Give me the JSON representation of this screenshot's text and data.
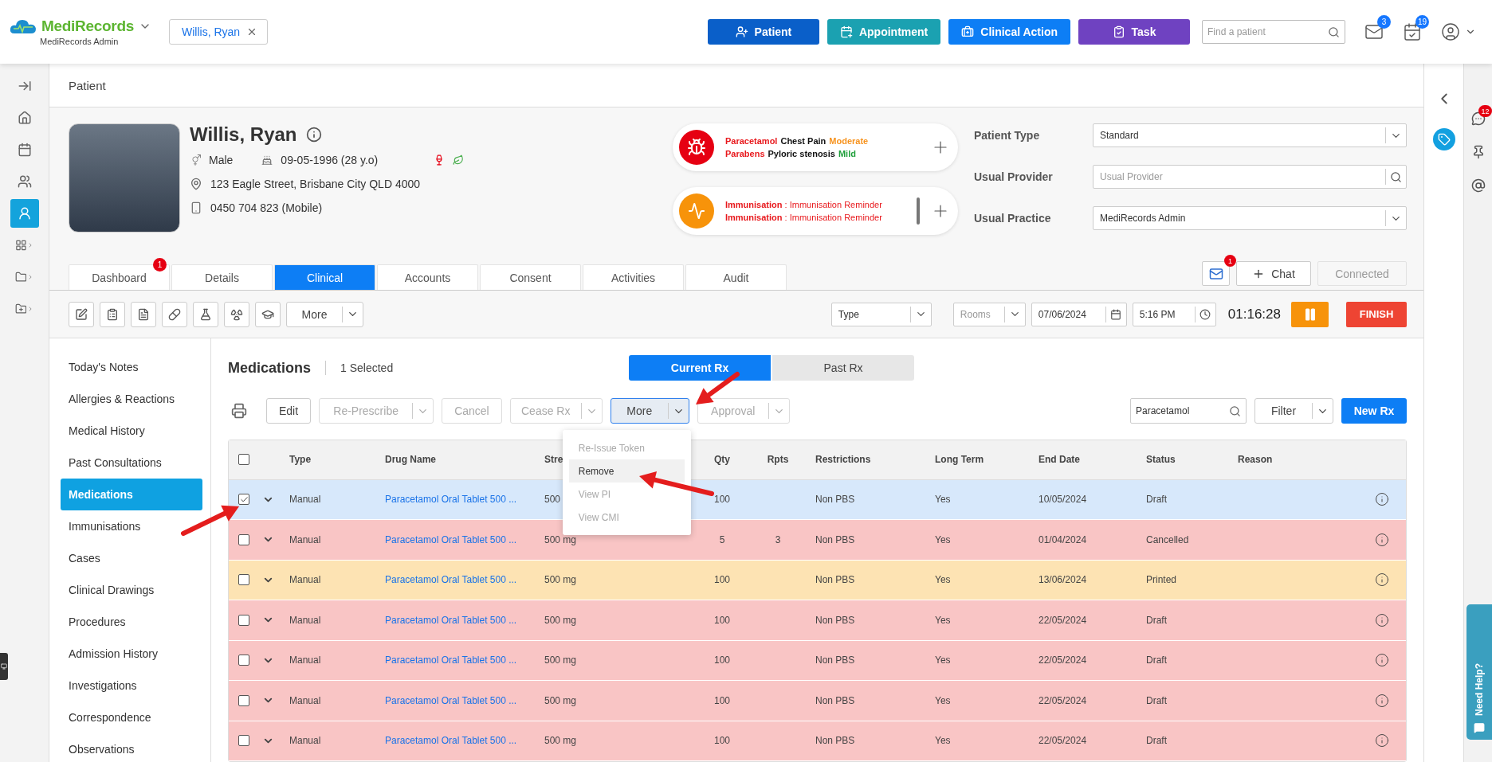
{
  "header": {
    "brand": "MediRecords",
    "brand_subtitle": "MediRecords Admin",
    "open_patient": "Willis, Ryan",
    "actions": [
      {
        "label": "Patient",
        "kind": "patient",
        "color": "#0a5fc9"
      },
      {
        "label": "Appointment",
        "kind": "appointment",
        "color": "#1ba1b1"
      },
      {
        "label": "Clinical Action",
        "kind": "clinical",
        "color": "#0d7ef5"
      },
      {
        "label": "Task",
        "kind": "task",
        "color": "#6f42c1"
      }
    ],
    "search": {
      "placeholder": "Find a patient"
    },
    "mail_badge": "3",
    "calendar_badge": "19"
  },
  "breadcrumb": "Patient",
  "patient": {
    "name": "Willis, Ryan",
    "gender": "Male",
    "dob": "09-05-1996 (28 y.o)",
    "address": "123 Eagle Street, Brisbane City QLD 4000",
    "phone": "0450 704 823 (Mobile)"
  },
  "allergies": [
    {
      "substance": "Paracetamol",
      "reaction": "Chest Pain",
      "severity": "Moderate",
      "color": "#f7931e"
    },
    {
      "substance": "Parabens",
      "reaction": "Pyloric stenosis",
      "severity": "Mild",
      "color": "#1e9e3a"
    }
  ],
  "reminders": [
    {
      "text": "**Immunisation** : Immunisation Reminder"
    },
    {
      "text": "**Immunisation** : Immunisation Reminder"
    }
  ],
  "fields": [
    {
      "label": "Patient Type",
      "kind": "select",
      "value": "Standard"
    },
    {
      "label": "Usual Provider",
      "kind": "search",
      "placeholder": "Usual Provider"
    },
    {
      "label": "Usual Practice",
      "kind": "select",
      "value": "MediRecords Admin"
    }
  ],
  "messages_badge": "1",
  "chat": "Chat",
  "connection": "Connected",
  "tabs": [
    {
      "label": "Dashboard",
      "selected": false,
      "badge": "1"
    },
    {
      "label": "Details",
      "selected": false
    },
    {
      "label": "Clinical",
      "selected": true
    },
    {
      "label": "Accounts",
      "selected": false
    },
    {
      "label": "Consent",
      "selected": false
    },
    {
      "label": "Activities",
      "selected": false
    },
    {
      "label": "Audit",
      "selected": false
    }
  ],
  "toolbar": {
    "more": "More",
    "type_placeholder": "Type",
    "rooms_placeholder": "Rooms",
    "date": "07/06/2024",
    "time": "5:16 PM",
    "timer": "01:16:28",
    "finish": "FINISH"
  },
  "side_panel": {
    "chat_badge": "12",
    "help": "Need Help?"
  },
  "nav": [
    {
      "label": "Today's Notes",
      "selected": false
    },
    {
      "label": "Allergies & Reactions",
      "selected": false
    },
    {
      "label": "Medical History",
      "selected": false
    },
    {
      "label": "Past Consultations",
      "selected": false
    },
    {
      "label": "Medications",
      "selected": true
    },
    {
      "label": "Immunisations",
      "selected": false
    },
    {
      "label": "Cases",
      "selected": false
    },
    {
      "label": "Clinical Drawings",
      "selected": false
    },
    {
      "label": "Procedures",
      "selected": false
    },
    {
      "label": "Admission History",
      "selected": false
    },
    {
      "label": "Investigations",
      "selected": false
    },
    {
      "label": "Correspondence",
      "selected": false
    },
    {
      "label": "Observations",
      "selected": false
    }
  ],
  "medications": {
    "title": "Medications",
    "selection": "1 Selected",
    "views": [
      {
        "label": "Current Rx",
        "selected": true
      },
      {
        "label": "Past Rx",
        "selected": false
      }
    ],
    "actions": [
      {
        "label": "Edit",
        "disabled": false,
        "split": false,
        "open": false
      },
      {
        "label": "Re-Prescribe",
        "disabled": true,
        "split": true,
        "open": false
      },
      {
        "label": "Cancel",
        "disabled": true,
        "split": false,
        "open": false
      },
      {
        "label": "Cease Rx",
        "disabled": true,
        "split": true,
        "open": false
      },
      {
        "label": "More",
        "disabled": false,
        "split": true,
        "open": true
      },
      {
        "label": "Approval",
        "disabled": true,
        "split": true,
        "open": false
      }
    ],
    "more_menu": [
      {
        "label": "Re-Issue Token",
        "disabled": true,
        "highlighted": false
      },
      {
        "label": "Remove",
        "disabled": false,
        "highlighted": true
      },
      {
        "label": "View PI",
        "disabled": true,
        "highlighted": false
      },
      {
        "label": "View CMI",
        "disabled": true,
        "highlighted": false
      }
    ],
    "search": "Paracetamol",
    "filter": "Filter",
    "new": "New Rx",
    "select_all": false,
    "columns": [
      "Type",
      "Drug Name",
      "Stre",
      "Qty",
      "Rpts",
      "Restrictions",
      "Long Term",
      "End Date",
      "Status",
      "Reason"
    ],
    "rows": [
      {
        "checked": true,
        "color": "#d7e8fb",
        "type": "Manual",
        "drug": "Paracetamol Oral Tablet 500 ...",
        "strength": "500",
        "qty": "100",
        "restrictions": "Non PBS",
        "long_term": "Yes",
        "end_date": "10/05/2024",
        "status": "Draft"
      },
      {
        "checked": false,
        "color": "#f9c5c5",
        "type": "Manual",
        "drug": "Paracetamol Oral Tablet 500 ...",
        "strength": "500 mg",
        "qty": "5",
        "rpts": "3",
        "restrictions": "Non PBS",
        "long_term": "Yes",
        "end_date": "01/04/2024",
        "status": "Cancelled"
      },
      {
        "checked": false,
        "color": "#fde3b3",
        "type": "Manual",
        "drug": "Paracetamol Oral Tablet 500 ...",
        "strength": "500 mg",
        "qty": "100",
        "restrictions": "Non PBS",
        "long_term": "Yes",
        "end_date": "13/06/2024",
        "status": "Printed"
      },
      {
        "checked": false,
        "color": "#f9c5c5",
        "type": "Manual",
        "drug": "Paracetamol Oral Tablet 500 ...",
        "strength": "500 mg",
        "qty": "100",
        "restrictions": "Non PBS",
        "long_term": "Yes",
        "end_date": "22/05/2024",
        "status": "Draft"
      },
      {
        "checked": false,
        "color": "#f9c5c5",
        "type": "Manual",
        "drug": "Paracetamol Oral Tablet 500 ...",
        "strength": "500 mg",
        "qty": "100",
        "restrictions": "Non PBS",
        "long_term": "Yes",
        "end_date": "22/05/2024",
        "status": "Draft"
      },
      {
        "checked": false,
        "color": "#f9c5c5",
        "type": "Manual",
        "drug": "Paracetamol Oral Tablet 500 ...",
        "strength": "500 mg",
        "qty": "100",
        "restrictions": "Non PBS",
        "long_term": "Yes",
        "end_date": "22/05/2024",
        "status": "Draft"
      },
      {
        "checked": false,
        "color": "#f9c5c5",
        "type": "Manual",
        "drug": "Paracetamol Oral Tablet 500 ...",
        "strength": "500 mg",
        "qty": "100",
        "restrictions": "Non PBS",
        "long_term": "Yes",
        "end_date": "22/05/2024",
        "status": "Draft"
      }
    ]
  }
}
